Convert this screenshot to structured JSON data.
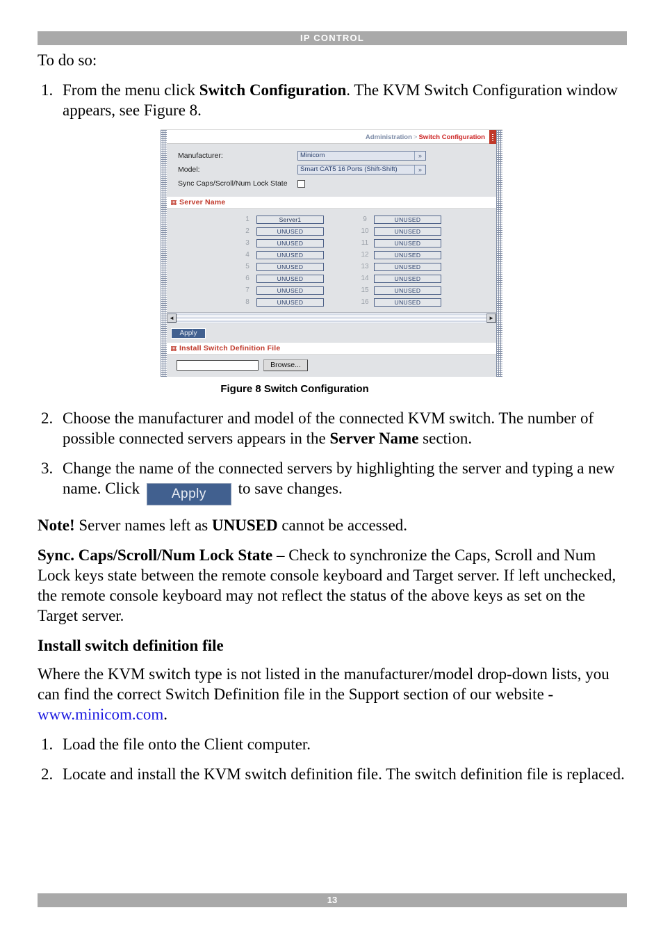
{
  "header": {
    "title": "IP CONTROL"
  },
  "footer": {
    "page_number": "13"
  },
  "intro": {
    "text": "To do so:"
  },
  "steps_top": [
    {
      "num": "1.",
      "part1": "From the menu click ",
      "bold1": "Switch Configuration",
      "part2": ". The KVM Switch Configuration window appears, see Figure 8."
    }
  ],
  "steps_after_figure": [
    {
      "num": "2.",
      "part1": "Choose the manufacturer and model of the connected KVM switch. The number of possible connected servers appears in the ",
      "bold1": "Server Name",
      "part2": " section."
    },
    {
      "num": "3.",
      "part1": "Change the name of the connected servers by highlighting the server and typing a new name. Click ",
      "inline_button": "Apply",
      "part2": " to save changes."
    }
  ],
  "note": {
    "bold1": "Note!",
    "part1": " Server names left as ",
    "bold2": "UNUSED",
    "part2": " cannot be accessed."
  },
  "sync_para": {
    "bold1": "Sync. Caps/Scroll/Num Lock State",
    "part1": " – Check to synchronize the Caps, Scroll and Num Lock keys state between the remote console keyboard and Target server. If left unchecked, the remote console keyboard may not reflect the status of the above keys as set on the Target server."
  },
  "install_section": {
    "heading": "Install switch definition file",
    "para_part1": "Where the KVM switch type is not listed in the manufacturer/model drop-down lists, you can find the correct Switch Definition file in the Support section of our website - ",
    "link_text": "www.minicom.com",
    "para_part2": ".",
    "steps": [
      {
        "num": "1.",
        "text": "Load the file onto the Client computer."
      },
      {
        "num": "2.",
        "text": "Locate and install the KVM switch definition file. The switch definition file is replaced."
      }
    ]
  },
  "figure": {
    "caption": "Figure 8 Switch Configuration",
    "breadcrumb": {
      "parent": "Administration",
      "separator": ">",
      "current": "Switch Configuration"
    },
    "form": {
      "manufacturer_label": "Manufacturer:",
      "manufacturer_value": "Minicom",
      "model_label": "Model:",
      "model_value": "Smart CAT5 16 Ports (Shift-Shift)",
      "sync_label": "Sync Caps/Scroll/Num Lock State",
      "sync_checked": false,
      "dropdown_glyph": "»"
    },
    "server_name_section": {
      "title": "Server Name",
      "ports": [
        {
          "index": "1",
          "name": "Server1"
        },
        {
          "index": "2",
          "name": "UNUSED"
        },
        {
          "index": "3",
          "name": "UNUSED"
        },
        {
          "index": "4",
          "name": "UNUSED"
        },
        {
          "index": "5",
          "name": "UNUSED"
        },
        {
          "index": "6",
          "name": "UNUSED"
        },
        {
          "index": "7",
          "name": "UNUSED"
        },
        {
          "index": "8",
          "name": "UNUSED"
        },
        {
          "index": "9",
          "name": "UNUSED"
        },
        {
          "index": "10",
          "name": "UNUSED"
        },
        {
          "index": "11",
          "name": "UNUSED"
        },
        {
          "index": "12",
          "name": "UNUSED"
        },
        {
          "index": "13",
          "name": "UNUSED"
        },
        {
          "index": "14",
          "name": "UNUSED"
        },
        {
          "index": "15",
          "name": "UNUSED"
        },
        {
          "index": "16",
          "name": "UNUSED"
        }
      ],
      "scroll_left_glyph": "◄",
      "scroll_right_glyph": "►",
      "apply_label": "Apply"
    },
    "install_file_section": {
      "title": "Install Switch Definition File",
      "file_value": "",
      "browse_label": "Browse..."
    }
  },
  "colors": {
    "header_bar": "#a9a9a9",
    "accent_red": "#c0392b",
    "panel_gray": "#e1e3e6",
    "button_blue": "#41608f",
    "field_text_blue": "#2a3f6b",
    "link_blue": "#1a18e0"
  }
}
